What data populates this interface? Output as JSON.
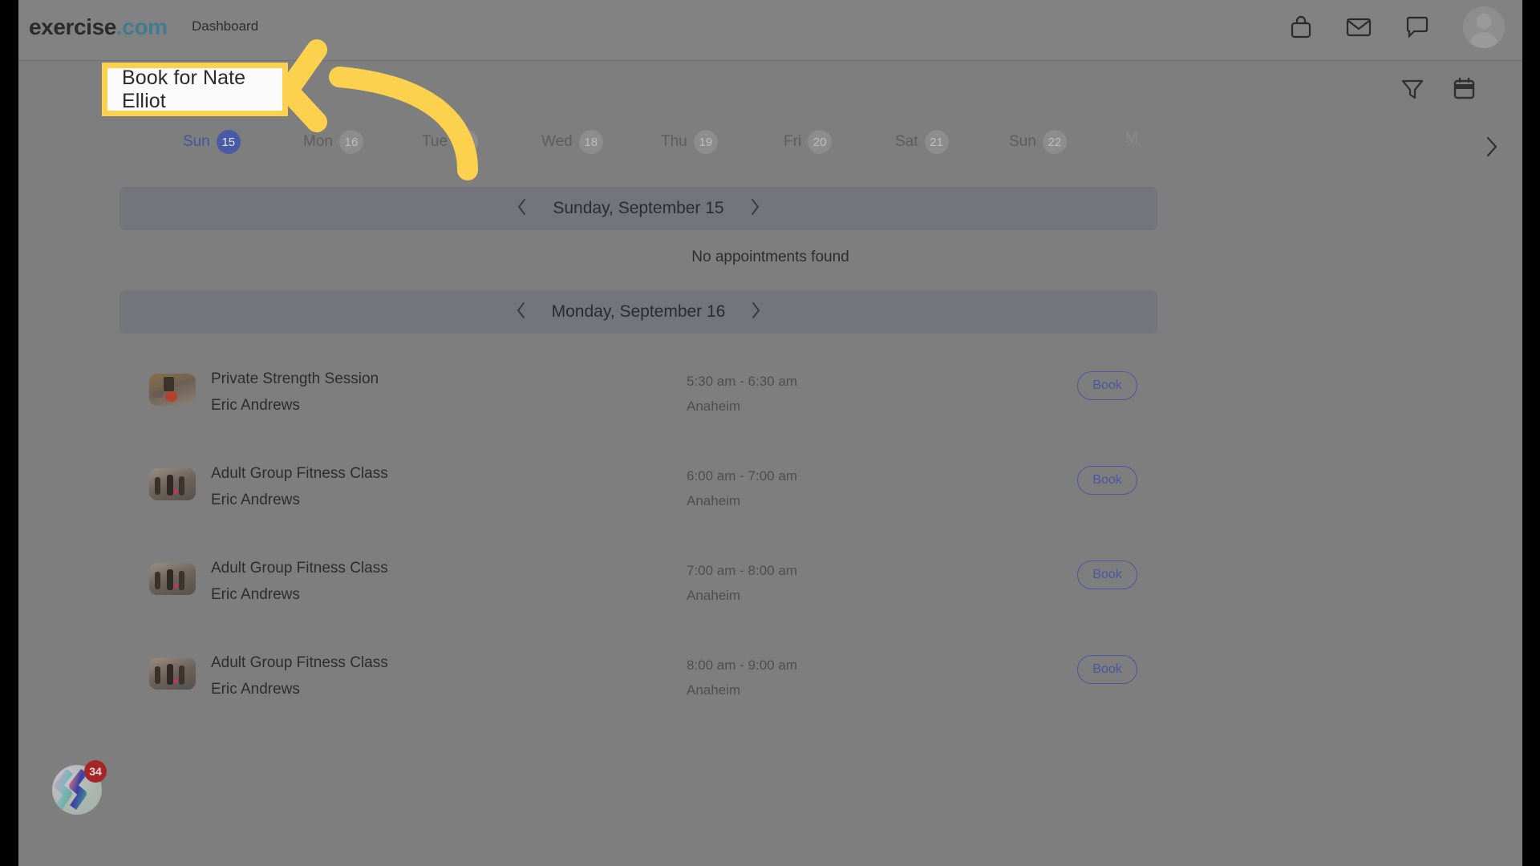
{
  "topbar": {
    "logo_main": "exercise",
    "logo_suffix": ".com",
    "nav_link": "Dashboard",
    "icons": [
      "shopping-bag-icon",
      "mail-icon",
      "chat-icon",
      "avatar"
    ]
  },
  "booking_header": {
    "title": "Book for Nate Elliot",
    "highlight_color": "#fcd14d",
    "tools": [
      "filter-icon",
      "calendar-icon"
    ]
  },
  "day_strip": {
    "days": [
      {
        "weekday": "Sun",
        "date": "15",
        "active": true
      },
      {
        "weekday": "Mon",
        "date": "16",
        "active": false
      },
      {
        "weekday": "Tue",
        "date": "17",
        "active": false
      },
      {
        "weekday": "Wed",
        "date": "18",
        "active": false
      },
      {
        "weekday": "Thu",
        "date": "19",
        "active": false
      },
      {
        "weekday": "Fri",
        "date": "20",
        "active": false
      },
      {
        "weekday": "Sat",
        "date": "21",
        "active": false
      },
      {
        "weekday": "Sun",
        "date": "22",
        "active": false
      },
      {
        "weekday": "M",
        "date": "",
        "active": false
      }
    ],
    "next_label": "next-day-chevron"
  },
  "sections": [
    {
      "date_label": "Sunday, September 15",
      "empty_message": "No appointments found",
      "appointments": []
    },
    {
      "date_label": "Monday, September 16",
      "empty_message": "",
      "appointments": [
        {
          "name": "Private Strength Session",
          "trainer": "Eric Andrews",
          "time": "5:30 am - 6:30 am",
          "location": "Anaheim",
          "action": "Book",
          "thumb": "kettlebell-photo"
        },
        {
          "name": "Adult Group Fitness Class",
          "trainer": "Eric Andrews",
          "time": "6:00 am - 7:00 am",
          "location": "Anaheim",
          "action": "Book",
          "thumb": "group-class-photo"
        },
        {
          "name": "Adult Group Fitness Class",
          "trainer": "Eric Andrews",
          "time": "7:00 am - 8:00 am",
          "location": "Anaheim",
          "action": "Book",
          "thumb": "group-class-photo"
        },
        {
          "name": "Adult Group Fitness Class",
          "trainer": "Eric Andrews",
          "time": "8:00 am - 9:00 am",
          "location": "Anaheim",
          "action": "Book",
          "thumb": "group-class-photo"
        }
      ]
    }
  ],
  "floating_widget": {
    "badge_count": "34",
    "badge_color": "#a52626"
  },
  "accent_colors": {
    "logo_accent": "#3f7d8c",
    "active_day": "#4a5ba6",
    "book_button": "#4a56a0",
    "highlight": "#fcd14d"
  }
}
